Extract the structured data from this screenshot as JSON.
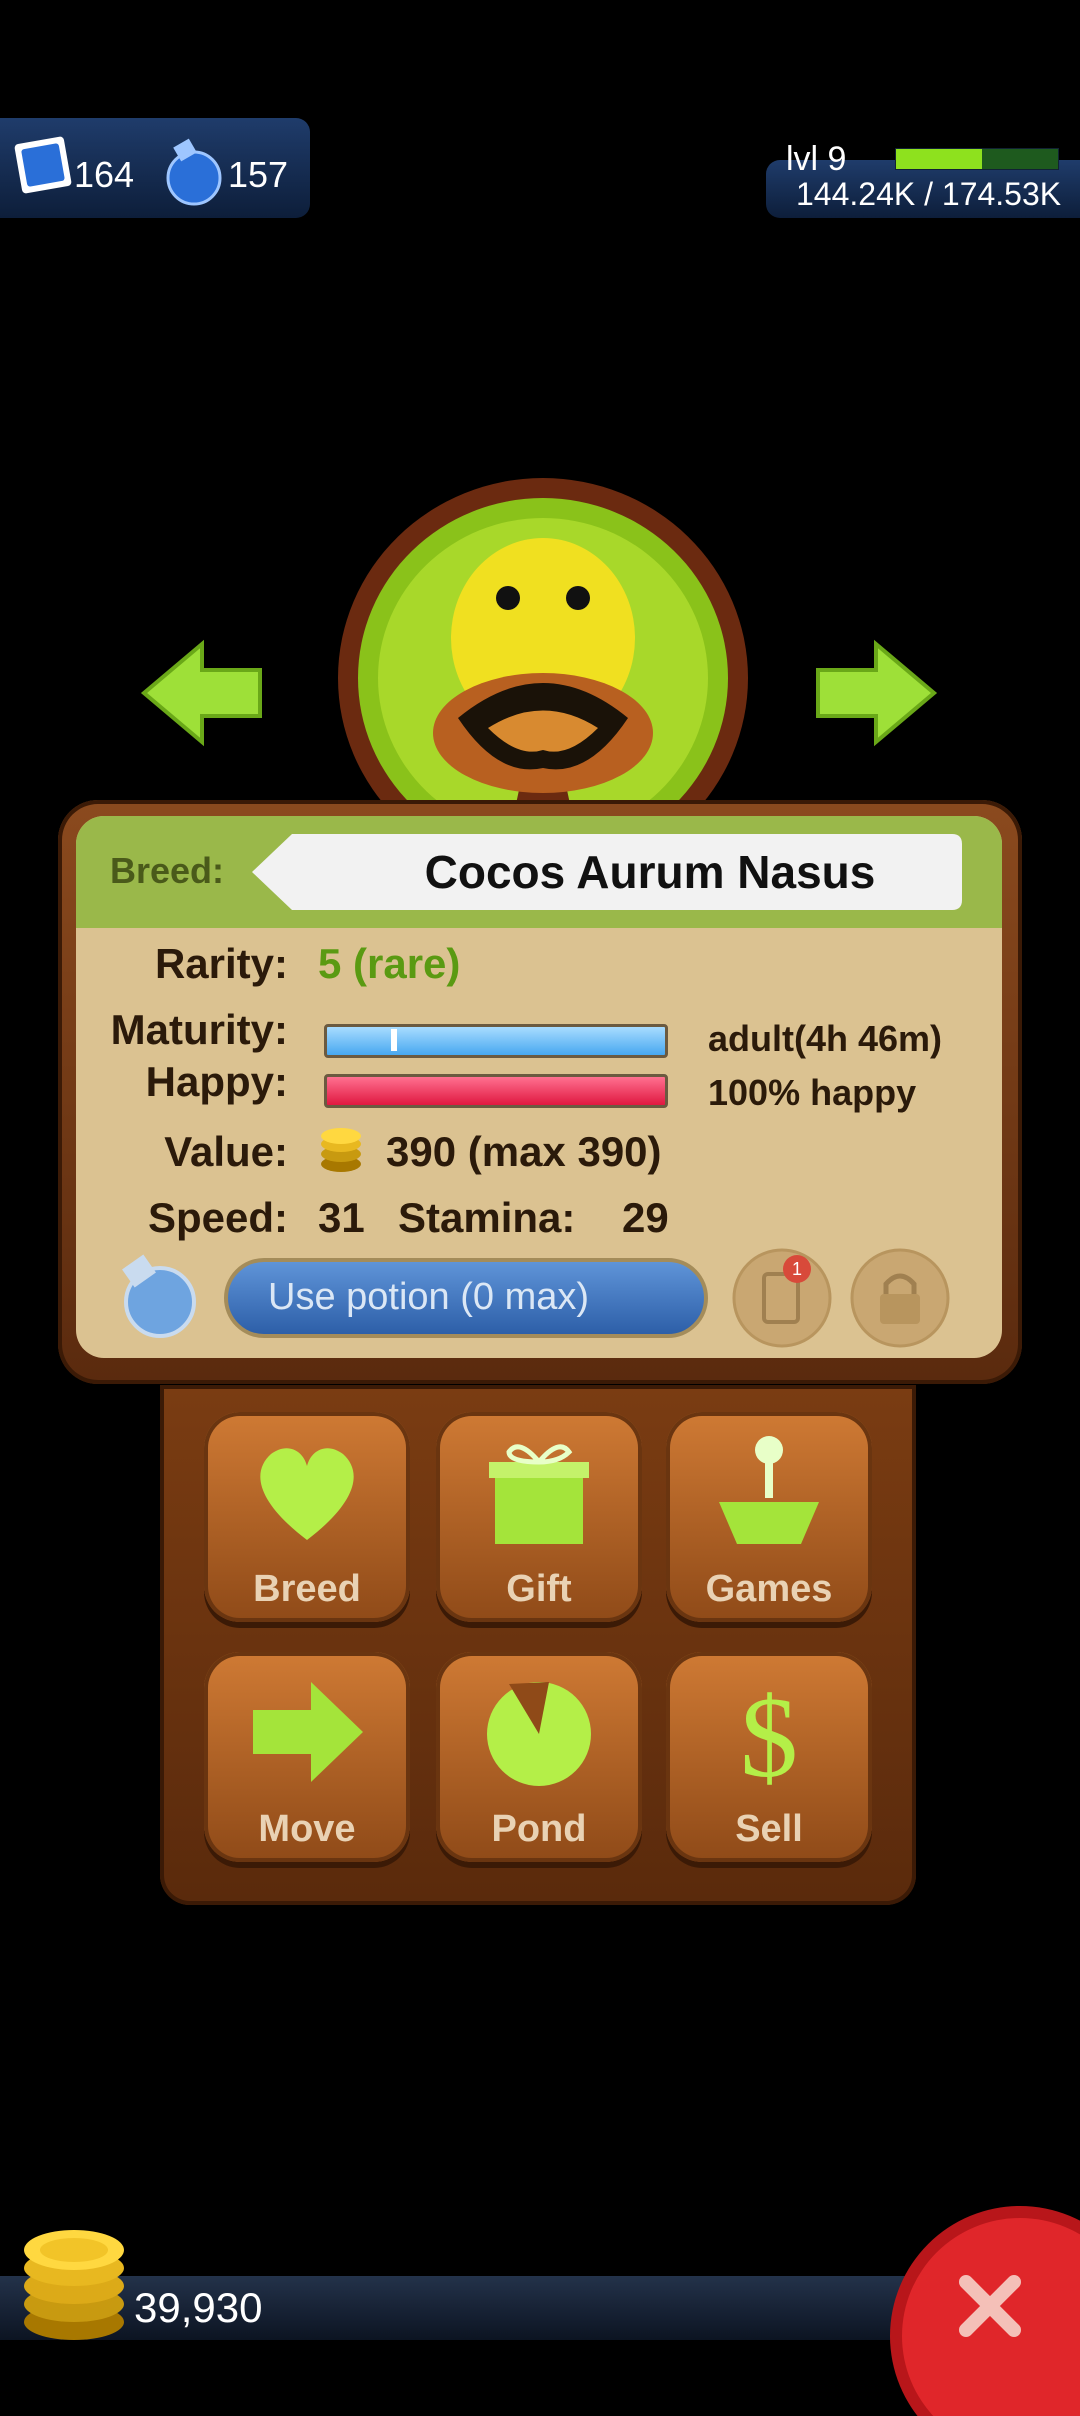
{
  "currency": {
    "stamps": "164",
    "potions": "157",
    "coins": "39,930"
  },
  "level": {
    "label": "lvl 9",
    "xp_text": "144.24K / 174.53K",
    "xp_progress": 0.53
  },
  "frog": {
    "breed_label": "Breed:",
    "breed_name": "Cocos Aurum Nasus"
  },
  "stats": {
    "rarity_label": "Rarity:",
    "rarity_value": "5 (rare)",
    "maturity_label": "Maturity:",
    "maturity_value": "adult(4h 46m)",
    "happy_label": "Happy:",
    "happy_value": "100% happy",
    "value_label": "Value:",
    "value_value": "390 (max 390)",
    "speed_label": "Speed:",
    "speed_value": "31",
    "stamina_label": "Stamina:",
    "stamina_value": "29",
    "happy_progress": 1.0
  },
  "potion": {
    "button_label": "Use potion (0 max)"
  },
  "actions": [
    {
      "label": "Breed",
      "icon": "heart-icon"
    },
    {
      "label": "Gift",
      "icon": "gift-icon"
    },
    {
      "label": "Games",
      "icon": "games-icon"
    },
    {
      "label": "Move",
      "icon": "arrow-right-icon"
    },
    {
      "label": "Pond",
      "icon": "pond-icon"
    },
    {
      "label": "Sell",
      "icon": "dollar-icon"
    }
  ],
  "badge": {
    "count": "1"
  },
  "colors": {
    "accent_green": "#8ee11e",
    "close_red": "#d81f22",
    "rarity_green": "#5a9a12"
  }
}
